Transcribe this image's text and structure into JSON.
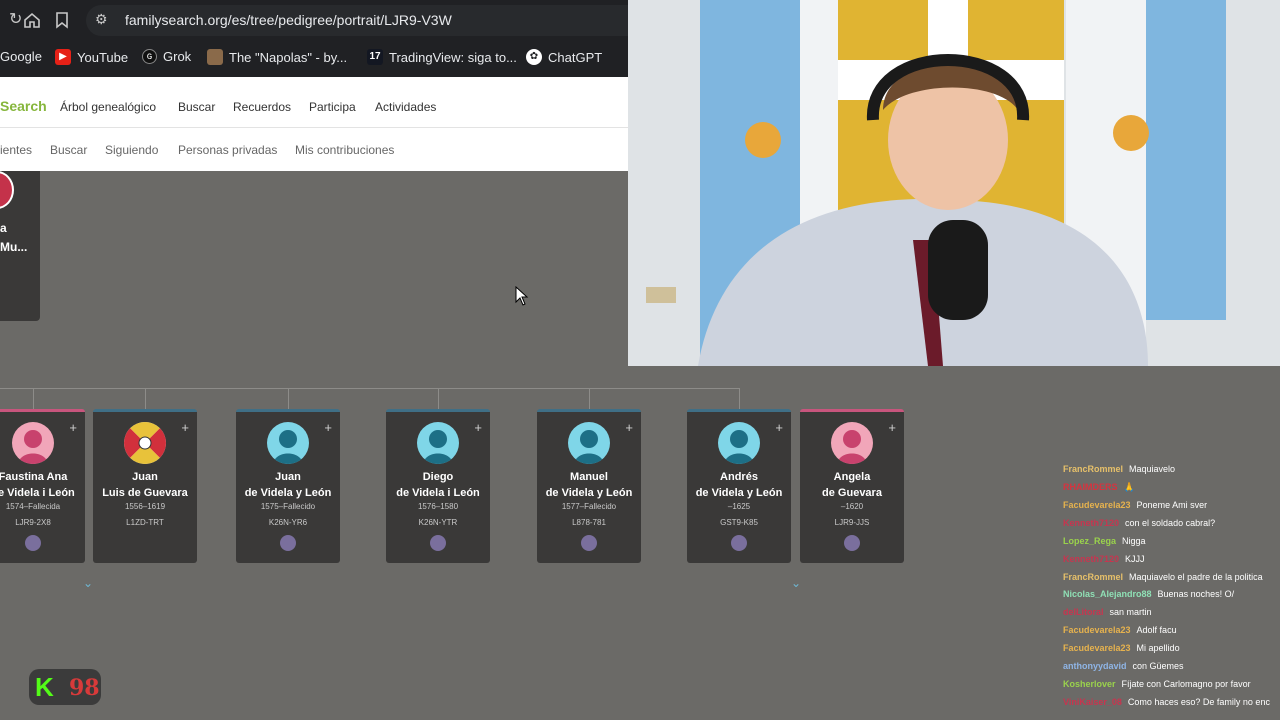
{
  "browser": {
    "url": "familysearch.org/es/tree/pedigree/portrait/LJR9-V3W",
    "bookmarks": [
      {
        "label": "Google",
        "icon": "google-icon"
      },
      {
        "label": "YouTube",
        "icon": "youtube-icon"
      },
      {
        "label": "Grok",
        "icon": "grok-icon"
      },
      {
        "label": "The \"Napolas\" - by...",
        "icon": "bookmark-thumbnail-icon"
      },
      {
        "label": "TradingView: siga to...",
        "icon": "tradingview-icon"
      },
      {
        "label": "ChatGPT",
        "icon": "chatgpt-icon"
      }
    ]
  },
  "familysearch": {
    "brand": "Search",
    "nav": [
      "Árbol genealógico",
      "Buscar",
      "Recuerdos",
      "Participa",
      "Actividades"
    ],
    "subnav": [
      "ientes",
      "Buscar",
      "Siguiendo",
      "Personas privadas",
      "Mis contribuciones"
    ]
  },
  "tree": {
    "top_card": {
      "line1": "a",
      "line2": "Mu..."
    },
    "children": [
      {
        "first": "Faustina Ana",
        "last": "de Videla i León",
        "dates": "1574–Fallecida",
        "id": "LJR9-2X8",
        "gender": "female"
      },
      {
        "first": "Juan",
        "last": "Luis de Guevara",
        "dates": "1556–1619",
        "id": "L1ZD-TRT",
        "gender": "heraldic"
      },
      {
        "first": "Juan",
        "last": "de Videla y León",
        "dates": "1575–Fallecido",
        "id": "K26N-YR6",
        "gender": "male"
      },
      {
        "first": "Diego",
        "last": "de Videla i León",
        "dates": "1576–1580",
        "id": "K26N-YTR",
        "gender": "male"
      },
      {
        "first": "Manuel",
        "last": "de Videla y León",
        "dates": "1577–Fallecido",
        "id": "L878-781",
        "gender": "male"
      },
      {
        "first": "Andrés",
        "last": "de Videla y León",
        "dates": "–1625",
        "id": "GST9-K85",
        "gender": "male"
      },
      {
        "first": "Angela",
        "last": "de Guevara",
        "dates": "–1620",
        "id": "LJR9-JJS",
        "gender": "female"
      }
    ]
  },
  "overlay": {
    "badge_letter": "K",
    "badge_count": "98"
  },
  "chat": [
    {
      "user": "FrancRommel",
      "color": "#e6c06a",
      "msg": "Maquiavelo"
    },
    {
      "user": "RHAIMDERS",
      "color": "#d6333f",
      "msg": "🙏"
    },
    {
      "user": "Facudevarela23",
      "color": "#e6b24e",
      "msg": "Poneme Ami sver"
    },
    {
      "user": "Kenneth7120",
      "color": "#c7354f",
      "msg": "con el soldado cabral?"
    },
    {
      "user": "Lopez_Rega",
      "color": "#9ad24c",
      "msg": "Nigga"
    },
    {
      "user": "Kenneth7120",
      "color": "#c7354f",
      "msg": "KJJJ"
    },
    {
      "user": "FrancRommel",
      "color": "#e6c06a",
      "msg": "Maquiavelo el padre de la politica"
    },
    {
      "user": "Nicolas_Alejandro88",
      "color": "#8fe0b5",
      "msg": "Buenas noches! O/"
    },
    {
      "user": "delLitoral",
      "color": "#c7354f",
      "msg": "san martin"
    },
    {
      "user": "Facudevarela23",
      "color": "#e6b24e",
      "msg": "Adolf facu"
    },
    {
      "user": "Facudevarela23",
      "color": "#e6b24e",
      "msg": "Mi apellido"
    },
    {
      "user": "anthonyydavid",
      "color": "#8fb5e6",
      "msg": "con Güemes"
    },
    {
      "user": "Kosherlover",
      "color": "#9ad24c",
      "msg": "Fíjate con Carlomagno por favor"
    },
    {
      "user": "ViniKaiser_08",
      "color": "#c7354f",
      "msg": "Como haces eso? De family no enc"
    }
  ]
}
